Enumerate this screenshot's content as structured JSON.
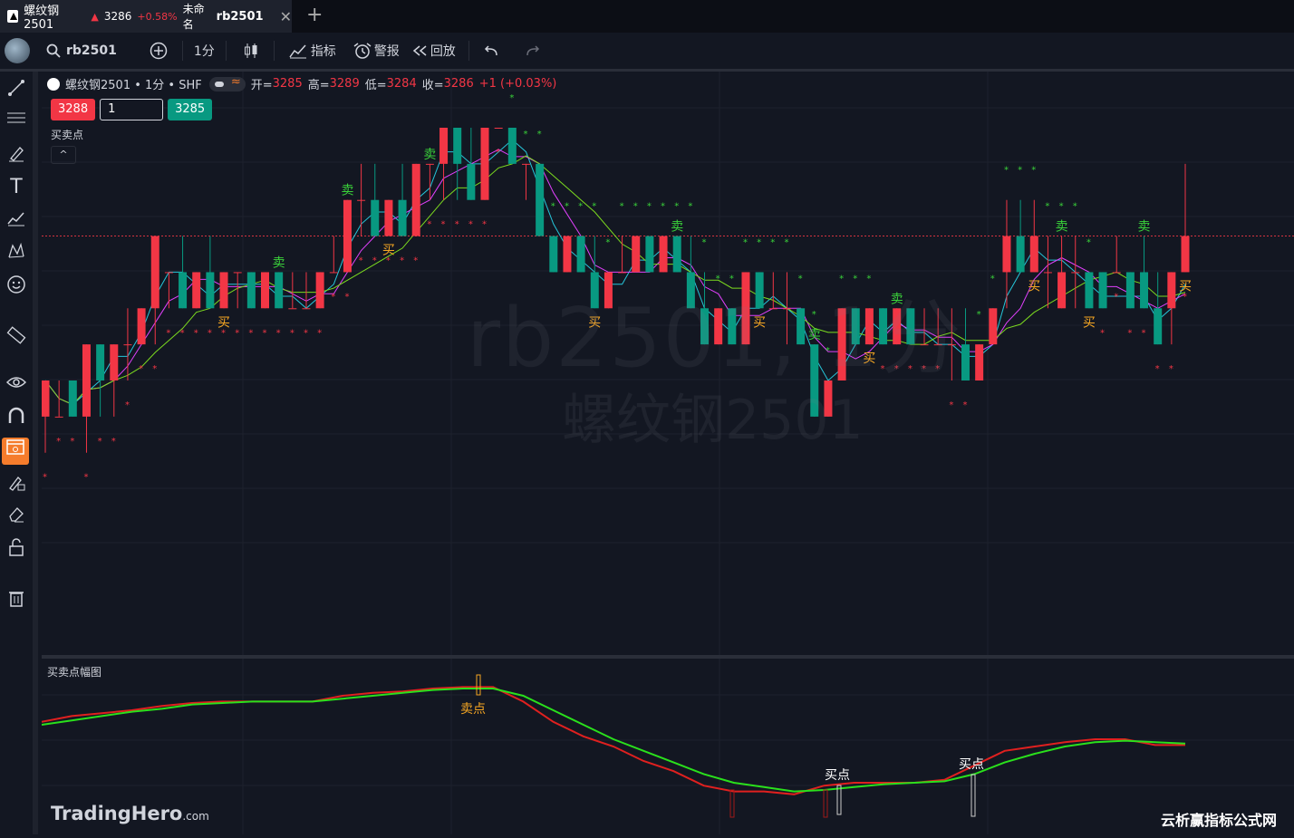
{
  "tab": {
    "symbol": "螺纹钢2501",
    "arrow": "▲",
    "price": "3286",
    "change": "+0.58%",
    "layout_name": "未命名",
    "code": "rb2501",
    "close_icon": "close-icon"
  },
  "toolbar": {
    "search_value": "rb2501",
    "interval": "1分",
    "indicators_label": "指标",
    "alerts_label": "警报",
    "replay_label": "回放"
  },
  "legend": {
    "title": "螺纹钢2501 • 1分 • SHF",
    "open_label": "开=",
    "open": "3285",
    "high_label": "高=",
    "high": "3289",
    "low_label": "低=",
    "low": "3284",
    "close_label": "收=",
    "close": "3286",
    "change": "+1 (+0.03%)"
  },
  "orders": {
    "sell_price": "3288",
    "quantity": "1",
    "buy_price": "3285"
  },
  "watermark": {
    "line1": "rb2501, 1分",
    "line2": "螺纹钢2501"
  },
  "study": {
    "main_title": "买卖点",
    "sub_title": "买卖点幅图"
  },
  "signals": {
    "buy": "买",
    "sell": "卖",
    "buy_point": "买点",
    "sell_point": "卖点"
  },
  "brand": {
    "name": "TradingHero",
    "suffix": ".com"
  },
  "corner_text": "云析赢指标公式网",
  "colors": {
    "up": "#f23645",
    "down": "#089981",
    "bg": "#131722",
    "buy_signal": "#f5a623",
    "sell_signal": "#3ad23a"
  },
  "chart_data": {
    "type": "candlestick",
    "symbol": "rb2501",
    "interval": "1分",
    "ylim": [
      3277,
      3291
    ],
    "candles": [
      {
        "o": 3283,
        "h": 3284,
        "l": 3282,
        "c": 3284
      },
      {
        "o": 3283,
        "h": 3284,
        "l": 3283,
        "c": 3283
      },
      {
        "o": 3284,
        "h": 3284,
        "l": 3283,
        "c": 3283
      },
      {
        "o": 3283,
        "h": 3285,
        "l": 3282,
        "c": 3285
      },
      {
        "o": 3285,
        "h": 3285,
        "l": 3283,
        "c": 3284
      },
      {
        "o": 3284,
        "h": 3285,
        "l": 3283,
        "c": 3285
      },
      {
        "o": 3285,
        "h": 3286,
        "l": 3284,
        "c": 3285
      },
      {
        "o": 3285,
        "h": 3286,
        "l": 3285,
        "c": 3286
      },
      {
        "o": 3286,
        "h": 3288,
        "l": 3285,
        "c": 3288
      },
      {
        "o": 3287,
        "h": 3287,
        "l": 3286,
        "c": 3287
      },
      {
        "o": 3287,
        "h": 3288,
        "l": 3286,
        "c": 3286
      },
      {
        "o": 3286,
        "h": 3287,
        "l": 3286,
        "c": 3287
      },
      {
        "o": 3287,
        "h": 3288,
        "l": 3286,
        "c": 3286
      },
      {
        "o": 3286,
        "h": 3287,
        "l": 3286,
        "c": 3287
      },
      {
        "o": 3287,
        "h": 3287,
        "l": 3286,
        "c": 3287
      },
      {
        "o": 3287,
        "h": 3287,
        "l": 3286,
        "c": 3286
      },
      {
        "o": 3286,
        "h": 3287,
        "l": 3286,
        "c": 3287
      },
      {
        "o": 3287,
        "h": 3287,
        "l": 3286,
        "c": 3286
      },
      {
        "o": 3286,
        "h": 3287,
        "l": 3286,
        "c": 3286
      },
      {
        "o": 3286,
        "h": 3287,
        "l": 3286,
        "c": 3286
      },
      {
        "o": 3286,
        "h": 3287,
        "l": 3286,
        "c": 3287
      },
      {
        "o": 3287,
        "h": 3288,
        "l": 3287,
        "c": 3287
      },
      {
        "o": 3287,
        "h": 3289,
        "l": 3287,
        "c": 3289
      },
      {
        "o": 3289,
        "h": 3290,
        "l": 3288,
        "c": 3289
      },
      {
        "o": 3289,
        "h": 3290,
        "l": 3288,
        "c": 3288
      },
      {
        "o": 3288,
        "h": 3289,
        "l": 3288,
        "c": 3289
      },
      {
        "o": 3289,
        "h": 3290,
        "l": 3288,
        "c": 3288
      },
      {
        "o": 3288,
        "h": 3290,
        "l": 3288,
        "c": 3290
      },
      {
        "o": 3290,
        "h": 3290,
        "l": 3289,
        "c": 3290
      },
      {
        "o": 3290,
        "h": 3291,
        "l": 3289,
        "c": 3291
      },
      {
        "o": 3291,
        "h": 3291,
        "l": 3289,
        "c": 3290
      },
      {
        "o": 3290,
        "h": 3291,
        "l": 3289,
        "c": 3289
      },
      {
        "o": 3289,
        "h": 3291,
        "l": 3289,
        "c": 3291
      },
      {
        "o": 3291,
        "h": 3291,
        "l": 3291,
        "c": 3291
      },
      {
        "o": 3291,
        "h": 3291,
        "l": 3290,
        "c": 3290
      },
      {
        "o": 3290,
        "h": 3290,
        "l": 3289,
        "c": 3290
      },
      {
        "o": 3290,
        "h": 3290,
        "l": 3288,
        "c": 3288
      },
      {
        "o": 3288,
        "h": 3288,
        "l": 3287,
        "c": 3287
      },
      {
        "o": 3287,
        "h": 3288,
        "l": 3287,
        "c": 3288
      },
      {
        "o": 3288,
        "h": 3288,
        "l": 3287,
        "c": 3287
      },
      {
        "o": 3287,
        "h": 3288,
        "l": 3286,
        "c": 3286
      },
      {
        "o": 3286,
        "h": 3287,
        "l": 3286,
        "c": 3287
      },
      {
        "o": 3287,
        "h": 3288,
        "l": 3287,
        "c": 3287
      },
      {
        "o": 3287,
        "h": 3288,
        "l": 3287,
        "c": 3288
      },
      {
        "o": 3288,
        "h": 3288,
        "l": 3287,
        "c": 3287
      },
      {
        "o": 3287,
        "h": 3288,
        "l": 3287,
        "c": 3288
      },
      {
        "o": 3288,
        "h": 3288,
        "l": 3287,
        "c": 3287
      },
      {
        "o": 3287,
        "h": 3288,
        "l": 3286,
        "c": 3286
      },
      {
        "o": 3286,
        "h": 3287,
        "l": 3285,
        "c": 3285
      },
      {
        "o": 3285,
        "h": 3286,
        "l": 3285,
        "c": 3286
      },
      {
        "o": 3286,
        "h": 3286,
        "l": 3285,
        "c": 3285
      },
      {
        "o": 3285,
        "h": 3287,
        "l": 3285,
        "c": 3287
      },
      {
        "o": 3287,
        "h": 3287,
        "l": 3286,
        "c": 3286
      },
      {
        "o": 3286,
        "h": 3287,
        "l": 3286,
        "c": 3286
      },
      {
        "o": 3286,
        "h": 3287,
        "l": 3285,
        "c": 3286
      },
      {
        "o": 3286,
        "h": 3286,
        "l": 3285,
        "c": 3285
      },
      {
        "o": 3285,
        "h": 3285,
        "l": 3283,
        "c": 3283
      },
      {
        "o": 3283,
        "h": 3284,
        "l": 3283,
        "c": 3284
      },
      {
        "o": 3284,
        "h": 3286,
        "l": 3284,
        "c": 3286
      },
      {
        "o": 3286,
        "h": 3286,
        "l": 3285,
        "c": 3285
      },
      {
        "o": 3285,
        "h": 3286,
        "l": 3285,
        "c": 3286
      },
      {
        "o": 3286,
        "h": 3286,
        "l": 3285,
        "c": 3285
      },
      {
        "o": 3285,
        "h": 3286,
        "l": 3285,
        "c": 3286
      },
      {
        "o": 3286,
        "h": 3286,
        "l": 3285,
        "c": 3285
      },
      {
        "o": 3285,
        "h": 3286,
        "l": 3285,
        "c": 3285
      },
      {
        "o": 3285,
        "h": 3286,
        "l": 3285,
        "c": 3285
      },
      {
        "o": 3285,
        "h": 3286,
        "l": 3284,
        "c": 3285
      },
      {
        "o": 3285,
        "h": 3286,
        "l": 3284,
        "c": 3284
      },
      {
        "o": 3284,
        "h": 3285,
        "l": 3284,
        "c": 3285
      },
      {
        "o": 3285,
        "h": 3286,
        "l": 3285,
        "c": 3286
      },
      {
        "o": 3287,
        "h": 3289,
        "l": 3286,
        "c": 3288
      },
      {
        "o": 3288,
        "h": 3289,
        "l": 3287,
        "c": 3287
      },
      {
        "o": 3287,
        "h": 3289,
        "l": 3287,
        "c": 3288
      },
      {
        "o": 3287,
        "h": 3288,
        "l": 3286,
        "c": 3287
      },
      {
        "o": 3286,
        "h": 3288,
        "l": 3286,
        "c": 3287
      },
      {
        "o": 3287,
        "h": 3288,
        "l": 3286,
        "c": 3287
      },
      {
        "o": 3287,
        "h": 3287,
        "l": 3286,
        "c": 3286
      },
      {
        "o": 3287,
        "h": 3287,
        "l": 3286,
        "c": 3286
      },
      {
        "o": 3287,
        "h": 3288,
        "l": 3287,
        "c": 3287
      },
      {
        "o": 3287,
        "h": 3287,
        "l": 3286,
        "c": 3286
      },
      {
        "o": 3287,
        "h": 3288,
        "l": 3286,
        "c": 3286
      },
      {
        "o": 3286,
        "h": 3287,
        "l": 3285,
        "c": 3285
      },
      {
        "o": 3286,
        "h": 3287,
        "l": 3285,
        "c": 3287
      },
      {
        "o": 3287,
        "h": 3290,
        "l": 3287,
        "c": 3288
      }
    ],
    "sub_series": [
      {
        "color": "#e0201f",
        "values": [
          0.72,
          0.76,
          0.78,
          0.8,
          0.83,
          0.85,
          0.86,
          0.86,
          0.86,
          0.86,
          0.9,
          0.92,
          0.93,
          0.95,
          0.96,
          0.96,
          0.86,
          0.72,
          0.62,
          0.55,
          0.45,
          0.38,
          0.28,
          0.24,
          0.24,
          0.22,
          0.28,
          0.3,
          0.3,
          0.3,
          0.32,
          0.42,
          0.52,
          0.55,
          0.58,
          0.6,
          0.6,
          0.56,
          0.56
        ]
      },
      {
        "color": "#2ae01c",
        "values": [
          0.7,
          0.73,
          0.76,
          0.79,
          0.81,
          0.84,
          0.85,
          0.86,
          0.86,
          0.86,
          0.88,
          0.9,
          0.92,
          0.94,
          0.95,
          0.95,
          0.9,
          0.8,
          0.7,
          0.6,
          0.52,
          0.44,
          0.36,
          0.3,
          0.27,
          0.24,
          0.25,
          0.27,
          0.29,
          0.3,
          0.31,
          0.36,
          0.44,
          0.5,
          0.55,
          0.58,
          0.59,
          0.58,
          0.57
        ]
      }
    ]
  }
}
